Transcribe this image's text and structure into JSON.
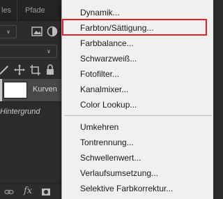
{
  "panel": {
    "tabs": [
      "les",
      "Pfade"
    ],
    "layers": {
      "adjustment_layer": "Kurven",
      "background_layer": "Hintergrund"
    },
    "bottom_bar_icons": [
      "link-icon",
      "fx-icon",
      "mask-icon"
    ]
  },
  "menu": {
    "group1": [
      "Dynamik...",
      "Farbton/Sättigung...",
      "Farbbalance...",
      "Schwarzweiß...",
      "Fotofilter...",
      "Kanalmixer...",
      "Color Lookup..."
    ],
    "group2": [
      "Umkehren",
      "Tontrennung...",
      "Schwellenwert...",
      "Verlaufsumsetzung...",
      "Selektive Farbkorrektur..."
    ],
    "highlighted": "Farbton/Sättigung...",
    "highlight_color": "#e0202a"
  }
}
